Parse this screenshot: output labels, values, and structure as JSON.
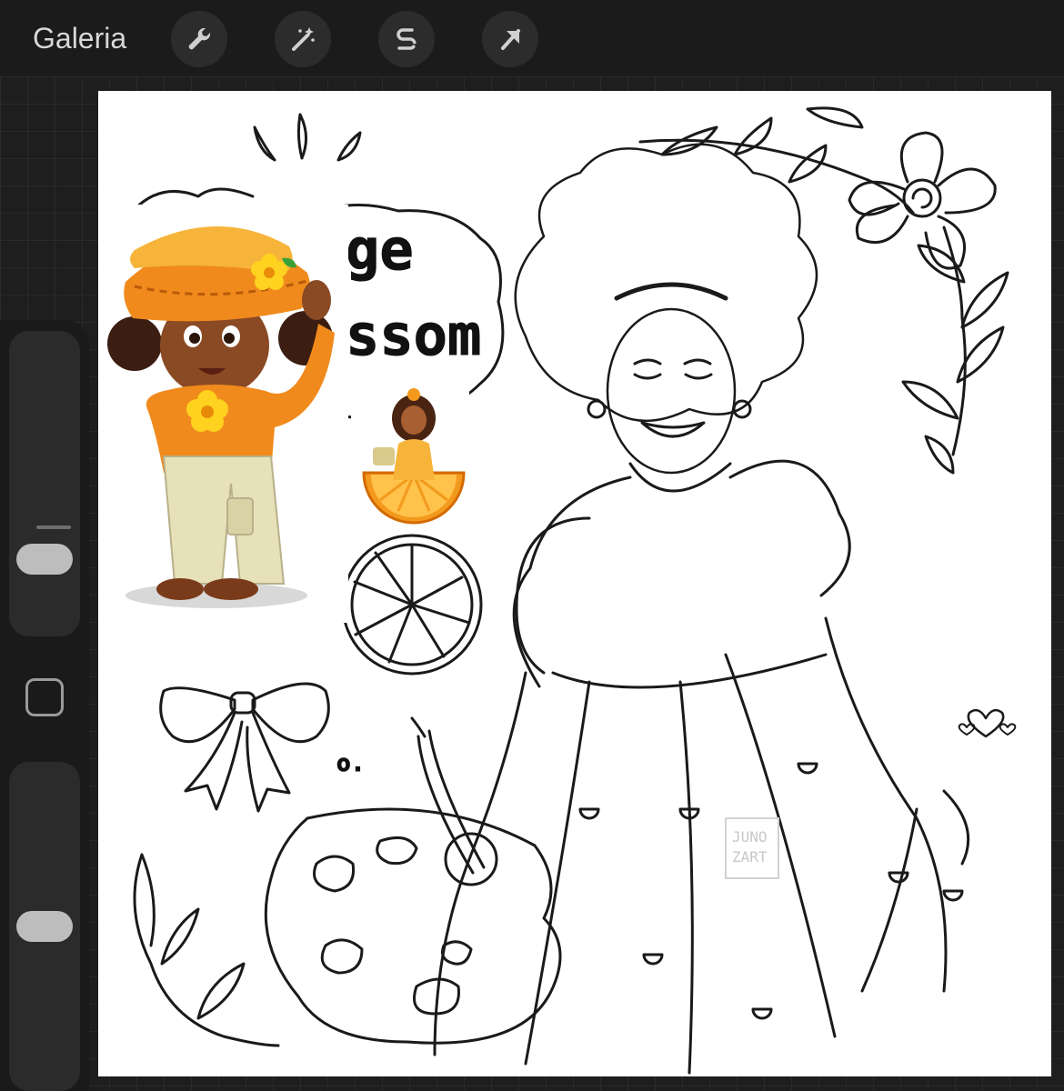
{
  "topbar": {
    "gallery_label": "Galeria",
    "tools": [
      {
        "icon": "wrench-icon",
        "name": "actions"
      },
      {
        "icon": "magic-wand-icon",
        "name": "adjustments"
      },
      {
        "icon": "selection-s-icon",
        "name": "selection"
      },
      {
        "icon": "transform-arrow-icon",
        "name": "transform"
      }
    ]
  },
  "sidebar": {
    "brush_size_level": 0.21,
    "opacity_level": 0.5,
    "modify_button_icon": "square-icon"
  },
  "canvas": {
    "lettering_line1": "ge",
    "lettering_line2": "ssom",
    "small_text": "o.",
    "watermark_line1": "JUNO",
    "watermark_line2": "ZART"
  },
  "colors": {
    "ui_background": "#1e1e1e",
    "toolbar": "#1b1b1b",
    "button": "#2c2c2c",
    "canvas": "#ffffff",
    "accent_orange": "#f08a1c"
  }
}
